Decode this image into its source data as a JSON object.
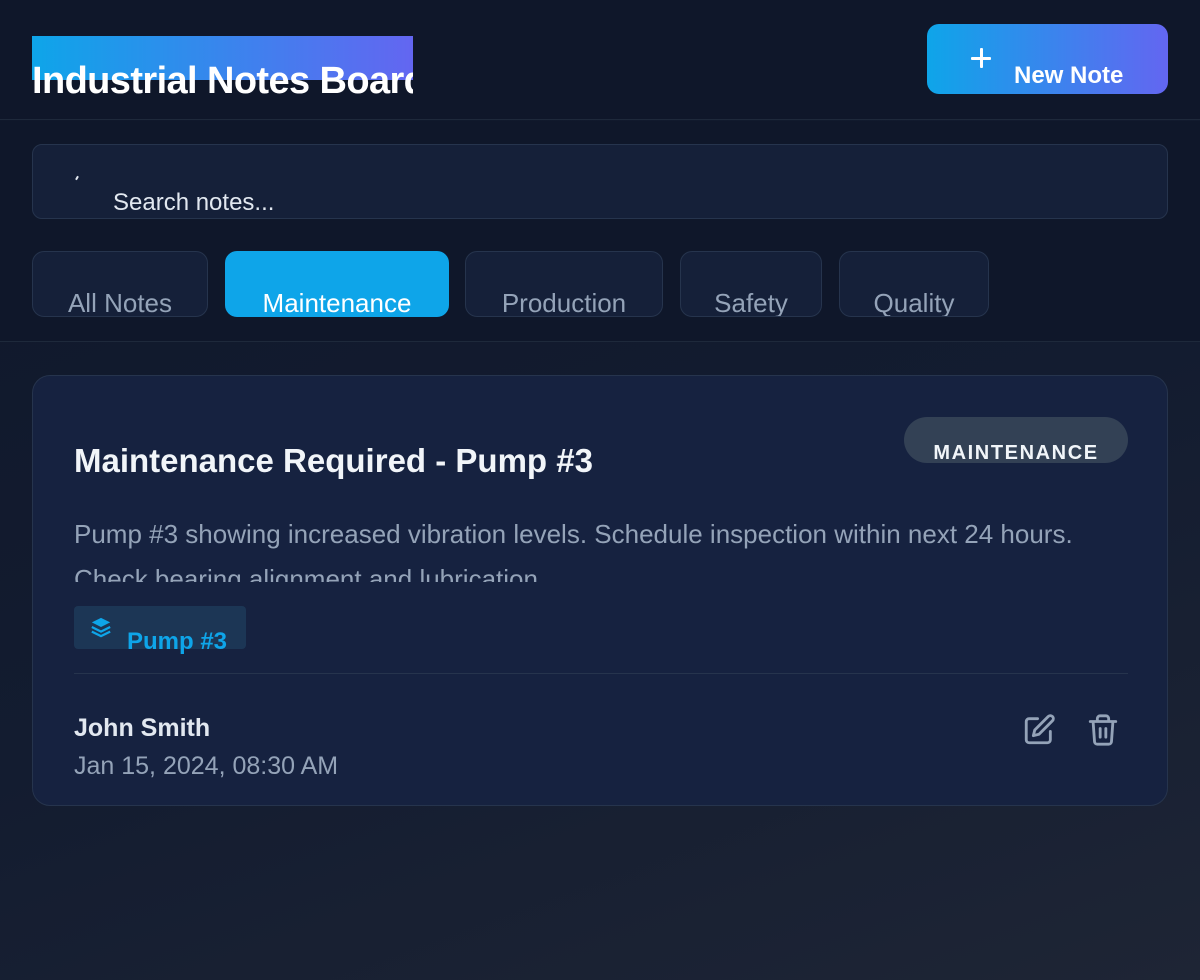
{
  "header": {
    "title": "Industrial Notes Board",
    "new_note_label": "New Note",
    "new_note_icon": "plus-icon"
  },
  "search": {
    "placeholder": "Search notes...",
    "icon": "search-icon"
  },
  "tabs": [
    {
      "label": "All Notes",
      "active": false
    },
    {
      "label": "Maintenance",
      "active": true
    },
    {
      "label": "Production",
      "active": false
    },
    {
      "label": "Safety",
      "active": false
    },
    {
      "label": "Quality",
      "active": false
    }
  ],
  "notes": [
    {
      "title": "Maintenance Required - Pump #3",
      "category": "MAINTENANCE",
      "body": "Pump #3 showing increased vibration levels. Schedule inspection within next 24 hours. Check bearing alignment and lubrication.",
      "equipment": "Pump #3",
      "equipment_icon": "layers-icon",
      "author": "John Smith",
      "timestamp": "Jan 15, 2024, 08:30 AM",
      "actions": [
        "edit-icon",
        "trash-icon"
      ]
    }
  ],
  "colors": {
    "accent": "#0ea5e9",
    "accent_gradient_end": "#6366f1",
    "background": "#0f172a",
    "card": "#162240",
    "muted_text": "#94a3b8"
  }
}
